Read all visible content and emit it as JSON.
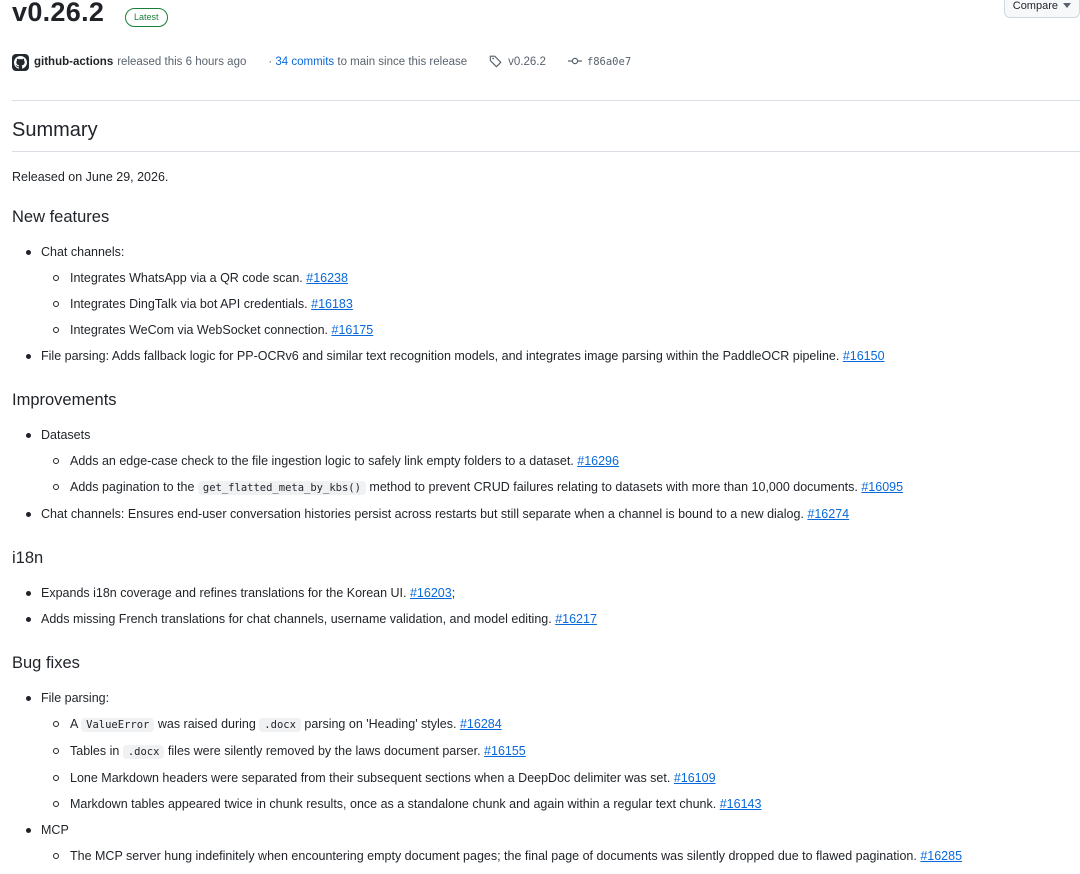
{
  "release": {
    "version": "v0.26.2",
    "badge": "Latest",
    "compare_label": "Compare",
    "author": "github-actions",
    "released_text": "released this 6 hours ago",
    "commits_link": "34 commits",
    "commits_text": "to main since this release",
    "tag": "v0.26.2",
    "commit": "f86a0e7"
  },
  "summary": {
    "heading": "Summary",
    "released_on": "Released on June 29, 2026."
  },
  "new_features": {
    "heading": "New features",
    "chat_channels": "Chat channels:",
    "whatsapp": "Integrates WhatsApp via a QR code scan.",
    "whatsapp_pr": "#16238",
    "dingtalk": "Integrates DingTalk via bot API credentials.",
    "dingtalk_pr": "#16183",
    "wecom": "Integrates WeCom via WebSocket connection.",
    "wecom_pr": "#16175",
    "file_parsing": "File parsing: Adds fallback logic for PP-OCRv6 and similar text recognition models, and integrates image parsing within the PaddleOCR pipeline.",
    "file_parsing_pr": "#16150"
  },
  "improvements": {
    "heading": "Improvements",
    "datasets": "Datasets",
    "edge_case": "Adds an edge-case check to the file ingestion logic to safely link empty folders to a dataset.",
    "edge_case_pr": "#16296",
    "pagination_pre": "Adds pagination to the",
    "pagination_code": "get_flatted_meta_by_kbs()",
    "pagination_post": "method to prevent CRUD failures relating to datasets with more than 10,000 documents.",
    "pagination_pr": "#16095",
    "chat": "Chat channels: Ensures end-user conversation histories persist across restarts but still separate when a channel is bound to a new dialog.",
    "chat_pr": "#16274"
  },
  "i18n": {
    "heading": "i18n",
    "korean": "Expands i18n coverage and refines translations for the Korean UI.",
    "korean_pr": "#16203",
    "korean_suffix": ";",
    "french": "Adds missing French translations for chat channels, username validation, and model editing.",
    "french_pr": "#16217"
  },
  "bug_fixes": {
    "heading": "Bug fixes",
    "file_parsing": "File parsing:",
    "valueerror_pre": "A",
    "valueerror_code": "ValueError",
    "valueerror_mid": "was raised during",
    "valueerror_code2": ".docx",
    "valueerror_post": "parsing on 'Heading' styles.",
    "valueerror_pr": "#16284",
    "tables_pre": "Tables in",
    "tables_code": ".docx",
    "tables_post": "files were silently removed by the laws document parser.",
    "tables_pr": "#16155",
    "headers": "Lone Markdown headers were separated from their subsequent sections when a DeepDoc delimiter was set.",
    "headers_pr": "#16109",
    "md_tables": "Markdown tables appeared twice in chunk results, once as a standalone chunk and again within a regular text chunk.",
    "md_tables_pr": "#16143",
    "mcp": "MCP",
    "mcp_hang": "The MCP server hung indefinitely when encountering empty document pages; the final page of documents was silently dropped due to flawed pagination.",
    "mcp_hang_pr": "#16285"
  },
  "icons": {
    "avatar": "github-logo-icon",
    "tag": "tag-icon",
    "commit": "git-commit-icon",
    "dropdown": "triangle-down-icon"
  },
  "colors": {
    "link": "#0969da",
    "badge": "#1a7f37",
    "text": "#1f2328",
    "muted": "#59636e"
  }
}
